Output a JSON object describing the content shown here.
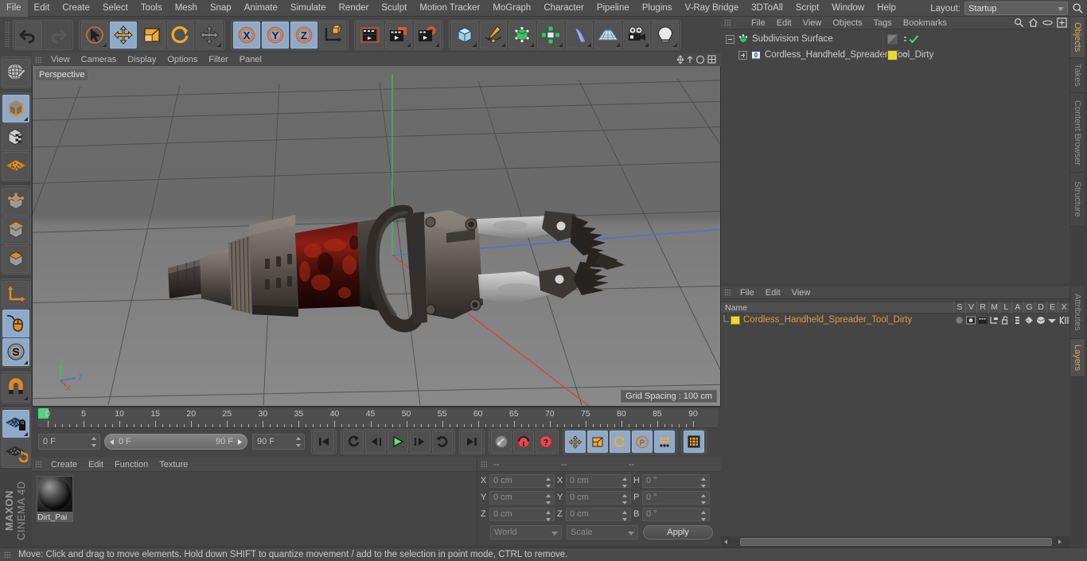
{
  "app": {
    "title": "MAXON CINEMA 4D",
    "brand_line1": "MAXON",
    "brand_line2": "CINEMA 4D"
  },
  "menubar": {
    "items": [
      "File",
      "Edit",
      "Create",
      "Select",
      "Tools",
      "Mesh",
      "Snap",
      "Animate",
      "Simulate",
      "Render",
      "Sculpt",
      "Motion Tracker",
      "MoGraph",
      "Character",
      "Pipeline",
      "Plugins",
      "V-Ray Bridge",
      "3DToAll",
      "Script",
      "Window",
      "Help"
    ],
    "layout_label": "Layout:",
    "layout_value": "Startup"
  },
  "toolbar": {
    "undo": "Undo",
    "redo": "Redo",
    "live_selection": "Live Selection",
    "move": "Move",
    "scale": "Scale",
    "rotate": "Rotate",
    "move_dyn": "Move (dynamic)",
    "axis_x": "X",
    "axis_y": "Y",
    "axis_z": "Z",
    "world_object": "World/Object Axis",
    "render_view": "Render View",
    "render_region": "Render to Picture Viewer",
    "render_settings": "Render Settings",
    "primitive_cube": "Cube",
    "spline_pen": "Pen",
    "nurbs": "Subdivision Surface",
    "array": "MoGraph / Array",
    "deformer": "Bend Deformer",
    "floor_env": "Floor / Environment",
    "camera": "Camera",
    "light": "Light"
  },
  "left_tools": {
    "items": [
      {
        "name": "make-editable",
        "label": "Make Editable",
        "selected": false
      },
      {
        "name": "model-mode",
        "label": "Model Mode",
        "selected": true
      },
      {
        "name": "texture-mode",
        "label": "Texture Mode",
        "selected": false
      },
      {
        "name": "workplane-mode",
        "label": "Workplane Mode",
        "selected": false
      },
      {
        "name": "points-mode",
        "label": "Points Mode",
        "selected": false
      },
      {
        "name": "edges-mode",
        "label": "Edges Mode",
        "selected": false
      },
      {
        "name": "polygons-mode",
        "label": "Polygons Mode",
        "selected": false
      },
      {
        "name": "axis-modify",
        "label": "Enable Axis Modification",
        "selected": false
      },
      {
        "name": "viewport-solo",
        "label": "Viewport Solo",
        "selected": true
      },
      {
        "name": "soft-selection",
        "label": "Soft Selection",
        "selected": true
      },
      {
        "name": "snap-magnet",
        "label": "Enable Snapping",
        "selected": false
      },
      {
        "name": "workplane-lock",
        "label": "Lock Workplane",
        "selected": true
      },
      {
        "name": "workplane-auto",
        "label": "Planar Workplane Mode",
        "selected": false
      }
    ]
  },
  "viewport": {
    "menu": [
      "View",
      "Cameras",
      "Display",
      "Options",
      "Filter",
      "Panel"
    ],
    "label": "Perspective",
    "grid_spacing": "Grid Spacing : 100 cm",
    "axis_x": "X",
    "axis_y": "Y",
    "axis_z": "Z",
    "axis_x_color": "#d8423c",
    "axis_y_color": "#3fc15a",
    "axis_z_color": "#4a6fe0"
  },
  "timeline": {
    "ticks": [
      "0",
      "5",
      "10",
      "15",
      "20",
      "25",
      "30",
      "35",
      "40",
      "45",
      "50",
      "55",
      "60",
      "65",
      "70",
      "75",
      "80",
      "85",
      "90"
    ],
    "current_frame": "0 F",
    "range_start": "0 F",
    "range_end": "90 F",
    "preview_end": "90 F",
    "second_frame_field": "0 F",
    "buttons": {
      "goto_start": "Go to Start",
      "prev_key": "Go to Previous Key",
      "prev_frame": "Go to Previous Frame",
      "play": "Play Forwards",
      "next_frame": "Go to Next Frame",
      "loop": "Loop Preview Range",
      "goto_end": "Go to End",
      "record": "Record Active Objects",
      "autokey": "Autokeying",
      "keyselection": "Keyframe Selection",
      "pos": "Position",
      "scale": "Scale",
      "rot": "Rotation",
      "pla": "Point Level Animation",
      "dots": "Parameter",
      "timeline_toggle": "Animation Layers"
    }
  },
  "material_manager": {
    "menu": [
      "Create",
      "Edit",
      "Function",
      "Texture"
    ],
    "materials": [
      {
        "name": "Dirt_Pai",
        "full_name": "Dirt_Paint"
      }
    ]
  },
  "coordinates": {
    "headers": [
      "--",
      "--",
      "--"
    ],
    "rows": [
      {
        "l1": "X",
        "v1": "0 cm",
        "l2": "X",
        "v2": "0 cm",
        "l3": "H",
        "v3": "0 °"
      },
      {
        "l1": "Y",
        "v1": "0 cm",
        "l2": "Y",
        "v2": "0 cm",
        "l3": "P",
        "v3": "0 °"
      },
      {
        "l1": "Z",
        "v1": "0 cm",
        "l2": "Z",
        "v2": "0 cm",
        "l3": "B",
        "v3": "0 °"
      }
    ],
    "system": "World",
    "mode": "Scale",
    "apply": "Apply"
  },
  "object_manager": {
    "menu": [
      "File",
      "Edit",
      "View",
      "Objects",
      "Tags",
      "Bookmarks"
    ],
    "tabs": [
      "Objects",
      "Takes",
      "Content Browser",
      "Structure"
    ],
    "active_tab": "Objects",
    "rows": [
      {
        "name": "Subdivision Surface",
        "indent": 0,
        "icon": "subdivision-surface-icon",
        "icon_color": "#47c77a",
        "has_check": true,
        "tag_color": "#8b8b8b"
      },
      {
        "name": "Cordless_Handheld_Spreader_Tool_Dirty",
        "indent": 1,
        "icon": "polygon-object-icon",
        "icon_color": "#4a9fe0",
        "has_check": false,
        "tag_color": "#e8d933"
      }
    ]
  },
  "layer_manager": {
    "menu": [
      "File",
      "Edit",
      "View"
    ],
    "tabs": [
      "Attributes",
      "Layers"
    ],
    "active_tab": "Layers",
    "columns": [
      "S",
      "V",
      "R",
      "M",
      "L",
      "A",
      "G",
      "D",
      "E",
      "X"
    ],
    "name_column": "Name",
    "rows": [
      {
        "name": "Cordless_Handheld_Spreader_Tool_Dirty",
        "color": "#e8d933",
        "text_color": "#e09a3e"
      }
    ]
  },
  "statusbar": {
    "message": "Move: Click and drag to move elements. Hold down SHIFT to quantize movement / add to the selection in point mode, CTRL to remove."
  }
}
